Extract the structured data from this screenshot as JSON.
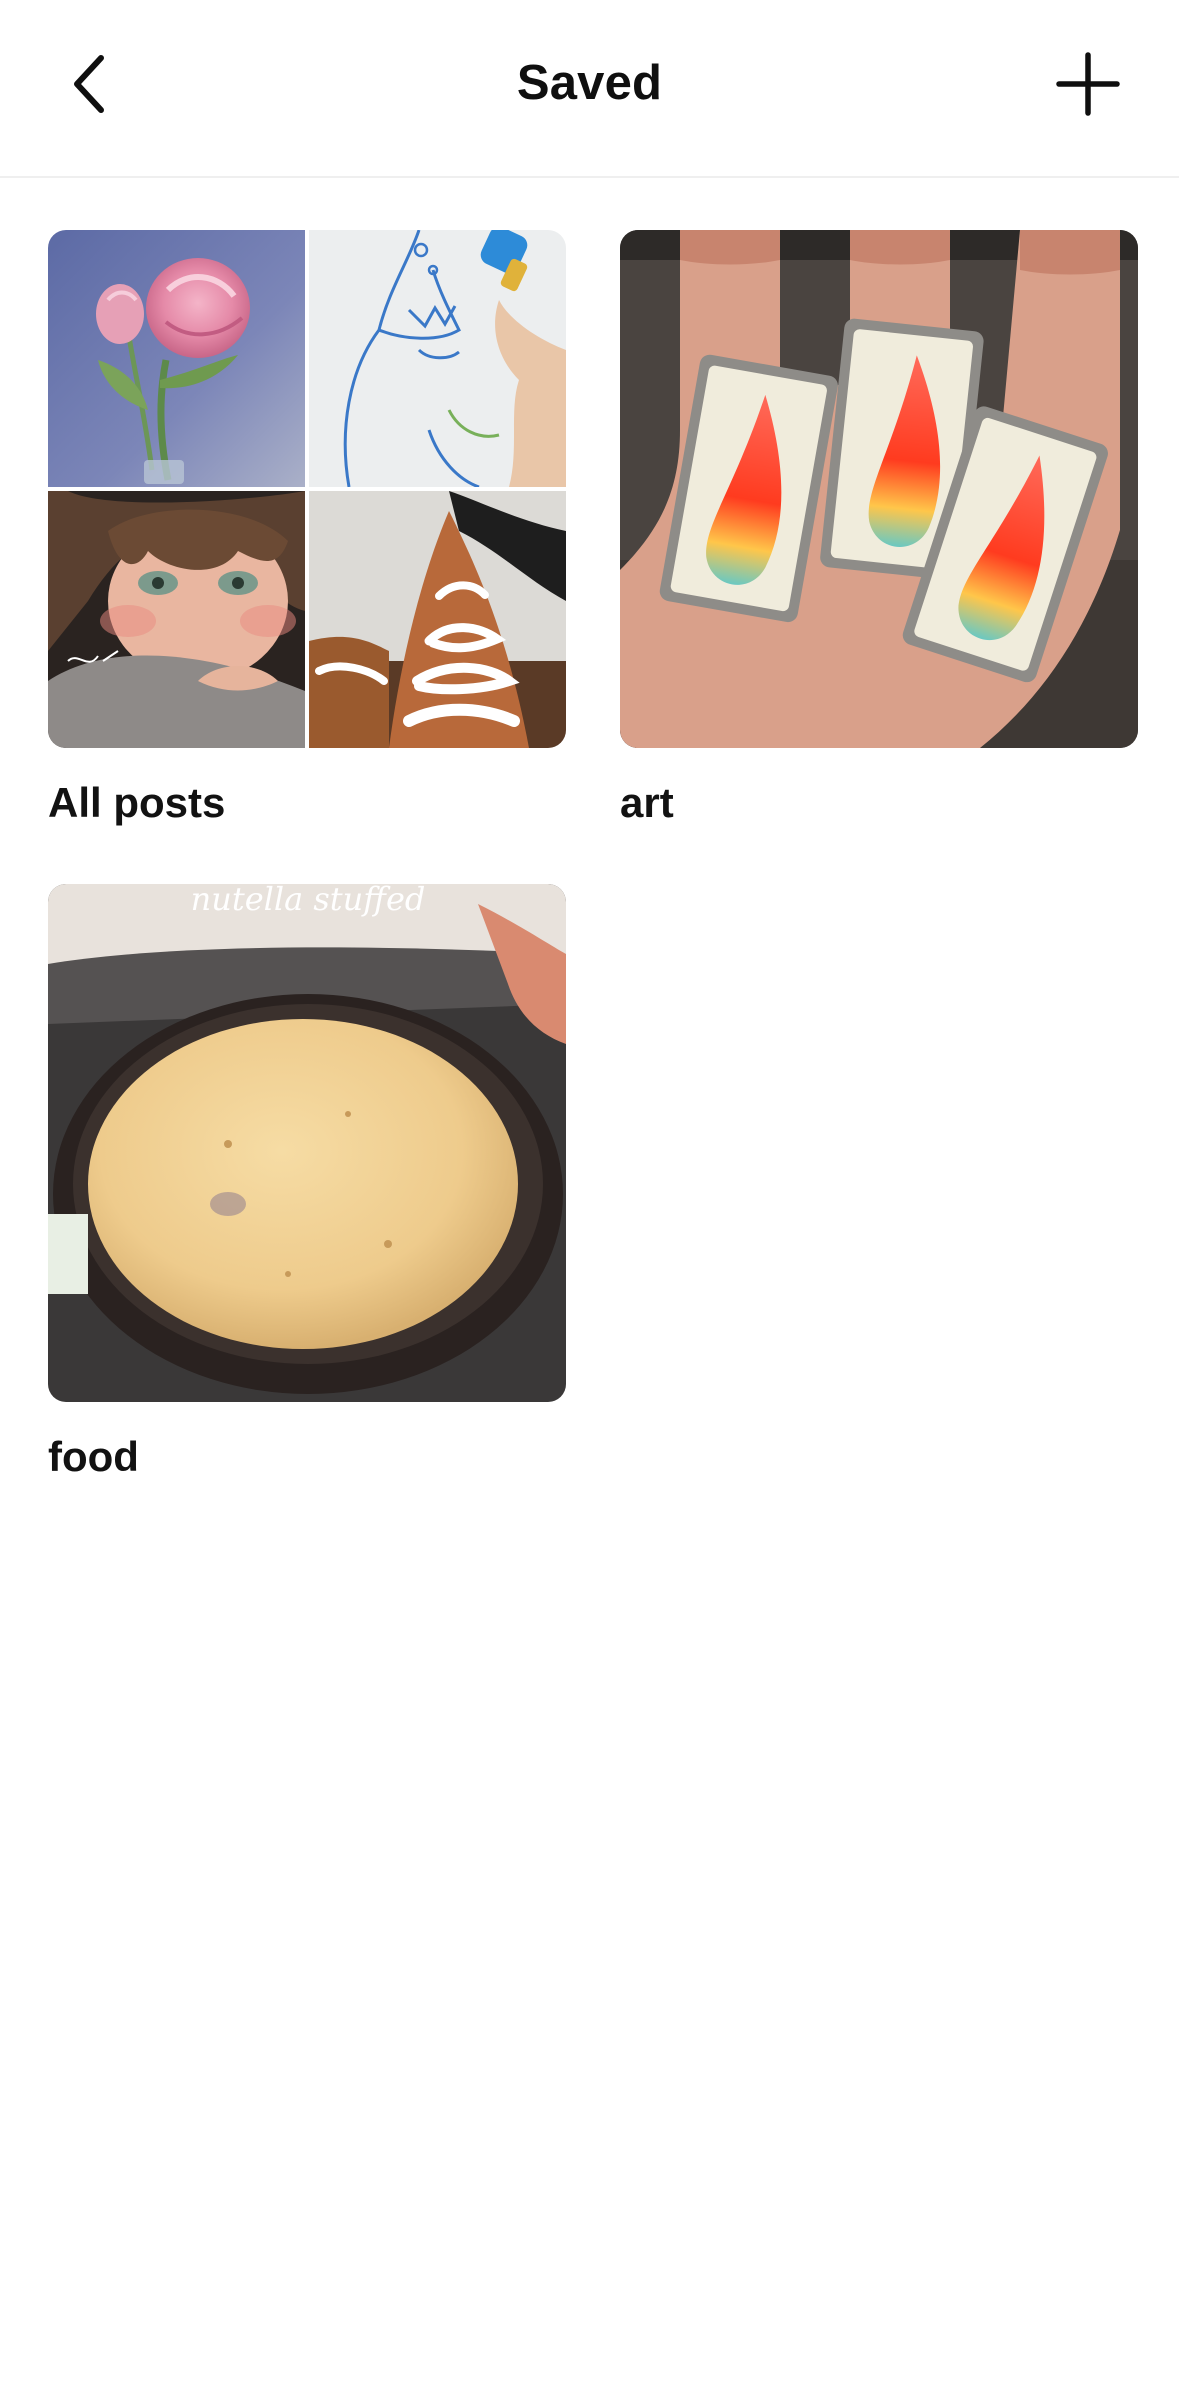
{
  "header": {
    "title": "Saved",
    "back_icon": "chevron-left-icon",
    "add_icon": "plus-icon"
  },
  "collections": [
    {
      "name": "All posts",
      "thumbnails": [
        "rose-painting",
        "shark-drawing",
        "anime-girl-illustration",
        "iced-pastry"
      ]
    },
    {
      "name": "art",
      "thumbnails": [
        "flame-rings-on-hand"
      ]
    },
    {
      "name": "food",
      "thumbnails": [
        "skillet-pancake"
      ],
      "overlay_text": "nutella stuffed"
    }
  ],
  "colors": {
    "background": "#ffffff",
    "text": "#121212",
    "divider": "#efefef"
  }
}
